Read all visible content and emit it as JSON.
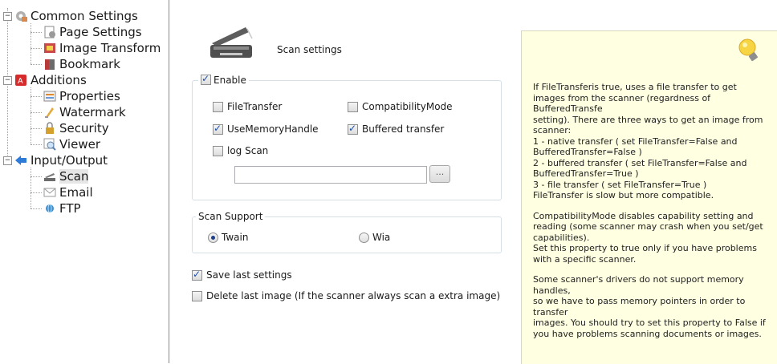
{
  "tree": {
    "common_settings": "Common Settings",
    "page_settings": "Page Settings",
    "image_transform": "Image Transform",
    "bookmark": "Bookmark",
    "additions": "Additions",
    "properties": "Properties",
    "watermark": "Watermark",
    "security": "Security",
    "viewer": "Viewer",
    "input_output": "Input/Output",
    "scan": "Scan",
    "email": "Email",
    "ftp": "FTP",
    "expander_symbol": "−"
  },
  "main": {
    "title": "Scan settings",
    "enable": {
      "label": "Enable",
      "checked": true
    },
    "file_transfer": {
      "label": "FileTransfer",
      "checked": false
    },
    "compatibility_mode": {
      "label": "CompatibilityMode",
      "checked": false
    },
    "use_memory_handle": {
      "label": "UseMemoryHandle",
      "checked": true
    },
    "buffered_transfer": {
      "label": "Buffered transfer",
      "checked": true
    },
    "log_scan": {
      "label": "log Scan",
      "checked": false
    },
    "log_path": "",
    "browse_label": "...",
    "scan_support": {
      "legend": "Scan Support",
      "twain": {
        "label": "Twain",
        "selected": true
      },
      "wia": {
        "label": "Wia",
        "selected": false
      }
    },
    "save_last": {
      "label": "Save last settings",
      "checked": true
    },
    "delete_last": {
      "label": "Delete last image (If the scanner always scan a extra image)",
      "checked": false
    }
  },
  "help": {
    "p1": "If FileTransferis true, uses a file transfer to get\nimages from the scanner (regardness of BufferedTransfe\nsetting). There are three ways to get an image from\nscanner:\n1 - native transfer ( set FileTransfer=False and\nBufferedTransfer=False )\n2 - buffered transfer ( set FileTransfer=False and\nBufferedTransfer=True )\n3 - file transfer ( set FileTransfer=True )\nFileTransfer is slow but more compatible.",
    "p2": "CompatibilityMode disables capability setting and\nreading (some scanner may crash when you set/get\ncapabilities).\nSet this property to true only if you have problems\nwith a specific scanner.",
    "p3": "Some scanner's drivers do not support memory handles,\nso we have to pass memory pointers in order to transfer\nimages. You should try to set this property to False if\nyou have problems scanning documents or images."
  },
  "colors": {
    "help_background": "#ffffe1",
    "checkmark": "#1f4fa8",
    "tree_selection": "#e6e6e6"
  },
  "icons": [
    "gear-icon",
    "page-settings-icon",
    "image-transform-icon",
    "bookmark-icon",
    "pdf-icon",
    "properties-icon",
    "watermark-icon",
    "security-lock-icon",
    "viewer-magnifier-icon",
    "arrow-icon",
    "scanner-icon",
    "email-envelope-icon",
    "ftp-icon",
    "lightbulb-icon"
  ]
}
